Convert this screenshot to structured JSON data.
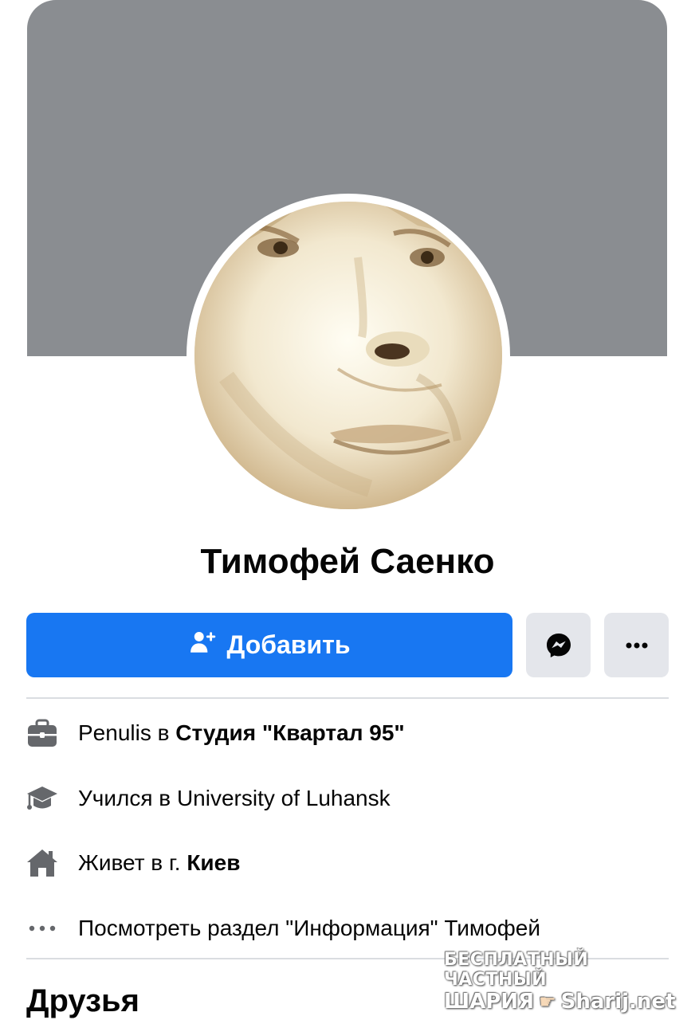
{
  "profile": {
    "name": "Тимофей Саенко"
  },
  "actions": {
    "add_label": "Добавить"
  },
  "info": {
    "work_prefix": "Penulis в ",
    "work_place": "Студия \"Квартал 95\"",
    "education": "Учился в University of Luhansk",
    "lives_prefix": "Живет в г. ",
    "lives_city": "Киев",
    "see_more": "Посмотреть раздел \"Информация\" Тимофей"
  },
  "sections": {
    "friends_title": "Друзья"
  },
  "watermark": {
    "line1": "БЕСПЛАТНЫЙ ЧАСТНЫЙ",
    "line2_left": "ШАРИЯ",
    "line2_right": "Sharij.net"
  },
  "icons": {
    "add": "add-friend-icon",
    "messenger": "messenger-icon",
    "more": "more-dots-icon",
    "work": "briefcase-icon",
    "education": "graduation-cap-icon",
    "home": "home-icon",
    "info_more": "ellipsis-icon"
  },
  "colors": {
    "primary": "#1877f2",
    "cover": "#8a8d91",
    "secondary_button": "#e4e6eb",
    "icon_gray": "#65676b"
  }
}
